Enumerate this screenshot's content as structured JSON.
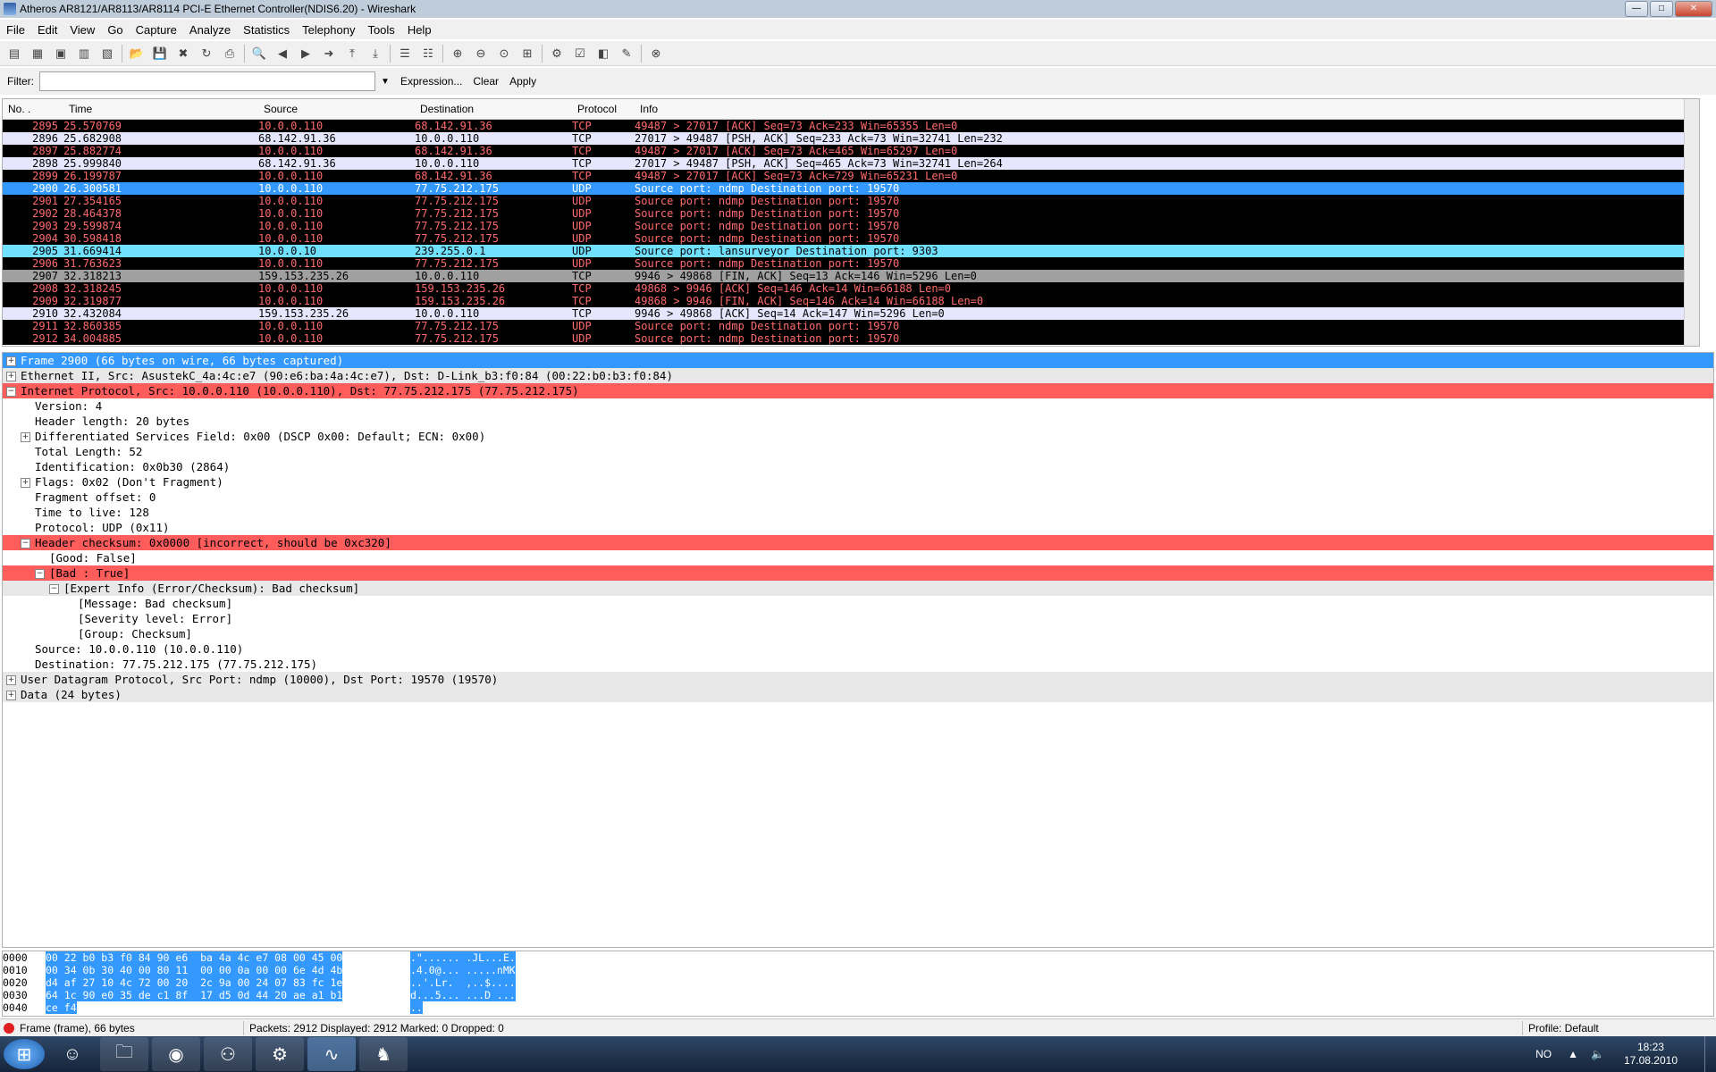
{
  "window": {
    "title": "Atheros AR8121/AR8113/AR8114 PCI-E Ethernet Controller(NDIS6.20) - Wireshark",
    "minimize_label": "—",
    "maximize_label": "□",
    "close_label": "✕"
  },
  "menu": [
    "File",
    "Edit",
    "View",
    "Go",
    "Capture",
    "Analyze",
    "Statistics",
    "Telephony",
    "Tools",
    "Help"
  ],
  "filter": {
    "label": "Filter:",
    "value": "",
    "expression_label": "Expression...",
    "clear_label": "Clear",
    "apply_label": "Apply"
  },
  "packet_list": {
    "columns": [
      "No. .",
      "Time",
      "Source",
      "Destination",
      "Protocol",
      "Info"
    ],
    "rows": [
      {
        "no": "2895",
        "time": "25.570769",
        "src": "10.0.0.110",
        "dst": "68.142.91.36",
        "proto": "TCP",
        "info": "49487 > 27017 [ACK] Seq=73 Ack=233 Win=65355 Len=0",
        "bg": "#000000",
        "fg": "#ff6b6b"
      },
      {
        "no": "2896",
        "time": "25.682908",
        "src": "68.142.91.36",
        "dst": "10.0.0.110",
        "proto": "TCP",
        "info": "27017 > 49487 [PSH, ACK] Seq=233 Ack=73 Win=32741 Len=232",
        "bg": "#e7e6ff",
        "fg": "#000000"
      },
      {
        "no": "2897",
        "time": "25.882774",
        "src": "10.0.0.110",
        "dst": "68.142.91.36",
        "proto": "TCP",
        "info": "49487 > 27017 [ACK] Seq=73 Ack=465 Win=65297 Len=0",
        "bg": "#000000",
        "fg": "#ff6b6b"
      },
      {
        "no": "2898",
        "time": "25.999840",
        "src": "68.142.91.36",
        "dst": "10.0.0.110",
        "proto": "TCP",
        "info": "27017 > 49487 [PSH, ACK] Seq=465 Ack=73 Win=32741 Len=264",
        "bg": "#e7e6ff",
        "fg": "#000000"
      },
      {
        "no": "2899",
        "time": "26.199787",
        "src": "10.0.0.110",
        "dst": "68.142.91.36",
        "proto": "TCP",
        "info": "49487 > 27017 [ACK] Seq=73 Ack=729 Win=65231 Len=0",
        "bg": "#000000",
        "fg": "#ff6b6b"
      },
      {
        "no": "2900",
        "time": "26.300581",
        "src": "10.0.0.110",
        "dst": "77.75.212.175",
        "proto": "UDP",
        "info": "Source port: ndmp  Destination port: 19570",
        "bg": "#3399ff",
        "fg": "#ffffff"
      },
      {
        "no": "2901",
        "time": "27.354165",
        "src": "10.0.0.110",
        "dst": "77.75.212.175",
        "proto": "UDP",
        "info": "Source port: ndmp  Destination port: 19570",
        "bg": "#000000",
        "fg": "#ff6b6b"
      },
      {
        "no": "2902",
        "time": "28.464378",
        "src": "10.0.0.110",
        "dst": "77.75.212.175",
        "proto": "UDP",
        "info": "Source port: ndmp  Destination port: 19570",
        "bg": "#000000",
        "fg": "#ff6b6b"
      },
      {
        "no": "2903",
        "time": "29.599874",
        "src": "10.0.0.110",
        "dst": "77.75.212.175",
        "proto": "UDP",
        "info": "Source port: ndmp  Destination port: 19570",
        "bg": "#000000",
        "fg": "#ff6b6b"
      },
      {
        "no": "2904",
        "time": "30.598418",
        "src": "10.0.0.110",
        "dst": "77.75.212.175",
        "proto": "UDP",
        "info": "Source port: ndmp  Destination port: 19570",
        "bg": "#000000",
        "fg": "#ff6b6b"
      },
      {
        "no": "2905",
        "time": "31.669414",
        "src": "10.0.0.10",
        "dst": "239.255.0.1",
        "proto": "UDP",
        "info": "Source port: lansurveyor  Destination port: 9303",
        "bg": "#70e0ff",
        "fg": "#000000"
      },
      {
        "no": "2906",
        "time": "31.763623",
        "src": "10.0.0.110",
        "dst": "77.75.212.175",
        "proto": "UDP",
        "info": "Source port: ndmp  Destination port: 19570",
        "bg": "#000000",
        "fg": "#ff6b6b"
      },
      {
        "no": "2907",
        "time": "32.318213",
        "src": "159.153.235.26",
        "dst": "10.0.0.110",
        "proto": "TCP",
        "info": "9946 > 49868 [FIN, ACK] Seq=13 Ack=146 Win=5296 Len=0",
        "bg": "#a0a0a0",
        "fg": "#000000"
      },
      {
        "no": "2908",
        "time": "32.318245",
        "src": "10.0.0.110",
        "dst": "159.153.235.26",
        "proto": "TCP",
        "info": "49868 > 9946 [ACK] Seq=146 Ack=14 Win=66188 Len=0",
        "bg": "#000000",
        "fg": "#ff6b6b"
      },
      {
        "no": "2909",
        "time": "32.319877",
        "src": "10.0.0.110",
        "dst": "159.153.235.26",
        "proto": "TCP",
        "info": "49868 > 9946 [FIN, ACK] Seq=146 Ack=14 Win=66188 Len=0",
        "bg": "#000000",
        "fg": "#ff6b6b"
      },
      {
        "no": "2910",
        "time": "32.432084",
        "src": "159.153.235.26",
        "dst": "10.0.0.110",
        "proto": "TCP",
        "info": "9946 > 49868 [ACK] Seq=14 Ack=147 Win=5296 Len=0",
        "bg": "#e7e6ff",
        "fg": "#000000"
      },
      {
        "no": "2911",
        "time": "32.860385",
        "src": "10.0.0.110",
        "dst": "77.75.212.175",
        "proto": "UDP",
        "info": "Source port: ndmp  Destination port: 19570",
        "bg": "#000000",
        "fg": "#ff6b6b"
      },
      {
        "no": "2912",
        "time": "34.004885",
        "src": "10.0.0.110",
        "dst": "77.75.212.175",
        "proto": "UDP",
        "info": "Source port: ndmp  Destination port: 19570",
        "bg": "#000000",
        "fg": "#ff6b6b"
      }
    ]
  },
  "details": [
    {
      "level": 0,
      "exp": "+",
      "text": "Frame 2900 (66 bytes on wire, 66 bytes captured)",
      "bg": "#3399ff",
      "fg": "#ffffff"
    },
    {
      "level": 0,
      "exp": "+",
      "text": "Ethernet II, Src: AsustekC_4a:4c:e7 (90:e6:ba:4a:4c:e7), Dst: D-Link_b3:f0:84 (00:22:b0:b3:f0:84)",
      "bg": "#e8e8e8",
      "fg": "#000000"
    },
    {
      "level": 0,
      "exp": "−",
      "text": "Internet Protocol, Src: 10.0.0.110 (10.0.0.110), Dst: 77.75.212.175 (77.75.212.175)",
      "bg": "#ff5c5c",
      "fg": "#000000"
    },
    {
      "level": 1,
      "exp": "",
      "text": "Version: 4",
      "bg": "",
      "fg": "#000000"
    },
    {
      "level": 1,
      "exp": "",
      "text": "Header length: 20 bytes",
      "bg": "",
      "fg": "#000000"
    },
    {
      "level": 1,
      "exp": "+",
      "text": "Differentiated Services Field: 0x00 (DSCP 0x00: Default; ECN: 0x00)",
      "bg": "",
      "fg": "#000000"
    },
    {
      "level": 1,
      "exp": "",
      "text": "Total Length: 52",
      "bg": "",
      "fg": "#000000"
    },
    {
      "level": 1,
      "exp": "",
      "text": "Identification: 0x0b30 (2864)",
      "bg": "",
      "fg": "#000000"
    },
    {
      "level": 1,
      "exp": "+",
      "text": "Flags: 0x02 (Don't Fragment)",
      "bg": "",
      "fg": "#000000"
    },
    {
      "level": 1,
      "exp": "",
      "text": "Fragment offset: 0",
      "bg": "",
      "fg": "#000000"
    },
    {
      "level": 1,
      "exp": "",
      "text": "Time to live: 128",
      "bg": "",
      "fg": "#000000"
    },
    {
      "level": 1,
      "exp": "",
      "text": "Protocol: UDP (0x11)",
      "bg": "",
      "fg": "#000000"
    },
    {
      "level": 1,
      "exp": "−",
      "text": "Header checksum: 0x0000 [incorrect, should be 0xc320]",
      "bg": "#ff5c5c",
      "fg": "#000000"
    },
    {
      "level": 2,
      "exp": "",
      "text": "[Good: False]",
      "bg": "",
      "fg": "#000000"
    },
    {
      "level": 2,
      "exp": "−",
      "text": "[Bad : True]",
      "bg": "#ff5c5c",
      "fg": "#000000"
    },
    {
      "level": 3,
      "exp": "−",
      "text": "[Expert Info (Error/Checksum): Bad checksum]",
      "bg": "#e8e8e8",
      "fg": "#000000"
    },
    {
      "level": 4,
      "exp": "",
      "text": "[Message: Bad checksum]",
      "bg": "",
      "fg": "#000000"
    },
    {
      "level": 4,
      "exp": "",
      "text": "[Severity level: Error]",
      "bg": "",
      "fg": "#000000"
    },
    {
      "level": 4,
      "exp": "",
      "text": "[Group: Checksum]",
      "bg": "",
      "fg": "#000000"
    },
    {
      "level": 1,
      "exp": "",
      "text": "Source: 10.0.0.110 (10.0.0.110)",
      "bg": "",
      "fg": "#000000"
    },
    {
      "level": 1,
      "exp": "",
      "text": "Destination: 77.75.212.175 (77.75.212.175)",
      "bg": "",
      "fg": "#000000"
    },
    {
      "level": 0,
      "exp": "+",
      "text": "User Datagram Protocol, Src Port: ndmp (10000), Dst Port: 19570 (19570)",
      "bg": "#e8e8e8",
      "fg": "#000000"
    },
    {
      "level": 0,
      "exp": "+",
      "text": "Data (24 bytes)",
      "bg": "#e8e8e8",
      "fg": "#000000"
    }
  ],
  "hex": [
    {
      "off": "0000",
      "bytes": "00 22 b0 b3 f0 84 90 e6  ba 4a 4c e7 08 00 45 00",
      "ascii": ".\"...... .JL...E."
    },
    {
      "off": "0010",
      "bytes": "00 34 0b 30 40 00 80 11  00 00 0a 00 00 6e 4d 4b",
      "ascii": ".4.0@... .....nMK"
    },
    {
      "off": "0020",
      "bytes": "d4 af 27 10 4c 72 00 20  2c 9a 00 24 07 83 fc 1e",
      "ascii": "..'.Lr.  ,..$...."
    },
    {
      "off": "0030",
      "bytes": "64 1c 90 e0 35 de c1 8f  17 d5 0d 44 20 ae a1 b1",
      "ascii": "d...5... ...D ..."
    },
    {
      "off": "0040",
      "bytes": "ce f4",
      "ascii": ".."
    }
  ],
  "status": {
    "frame_info": "Frame (frame), 66 bytes",
    "packets": "Packets: 2912 Displayed: 2912 Marked: 0 Dropped: 0",
    "profile": "Profile: Default"
  },
  "taskbar": {
    "lang": "NO",
    "time": "18:23",
    "date": "17.08.2010"
  }
}
